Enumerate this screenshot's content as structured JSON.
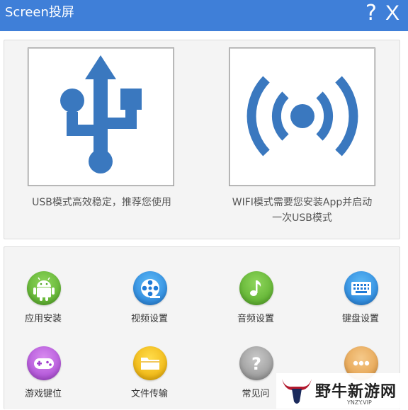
{
  "window": {
    "title": "Screen投屏",
    "help_label": "?",
    "close_label": "X"
  },
  "modes": {
    "usb": {
      "icon": "usb-icon",
      "description": "USB模式高效稳定，推荐您使用"
    },
    "wifi": {
      "icon": "wifi-signal-icon",
      "description_line1": "WIFI模式需要您安装App并启动",
      "description_line2": "一次USB模式"
    }
  },
  "tools": [
    {
      "label": "应用安装",
      "icon": "android-icon",
      "color": "#5cb82e"
    },
    {
      "label": "视频设置",
      "icon": "film-reel-icon",
      "color": "#2a8ae3"
    },
    {
      "label": "音频设置",
      "icon": "music-note-icon",
      "color": "#5cb82e"
    },
    {
      "label": "键盘设置",
      "icon": "keyboard-icon",
      "color": "#2a8ae3"
    },
    {
      "label": "游戏键位",
      "icon": "gamepad-icon",
      "color": "#b84fdc"
    },
    {
      "label": "文件传输",
      "icon": "folder-icon",
      "color": "#f2bd12"
    },
    {
      "label": "常见问",
      "icon": "question-icon",
      "color": "#a0a0a0"
    },
    {
      "label": "",
      "icon": "more-icon",
      "color": "#e9aa55"
    }
  ],
  "watermark": {
    "text": "野牛新游网",
    "sub": "YNZY.VIP"
  },
  "colors": {
    "titlebar": "#3f7fd8",
    "usb_icon": "#3a78bf"
  }
}
